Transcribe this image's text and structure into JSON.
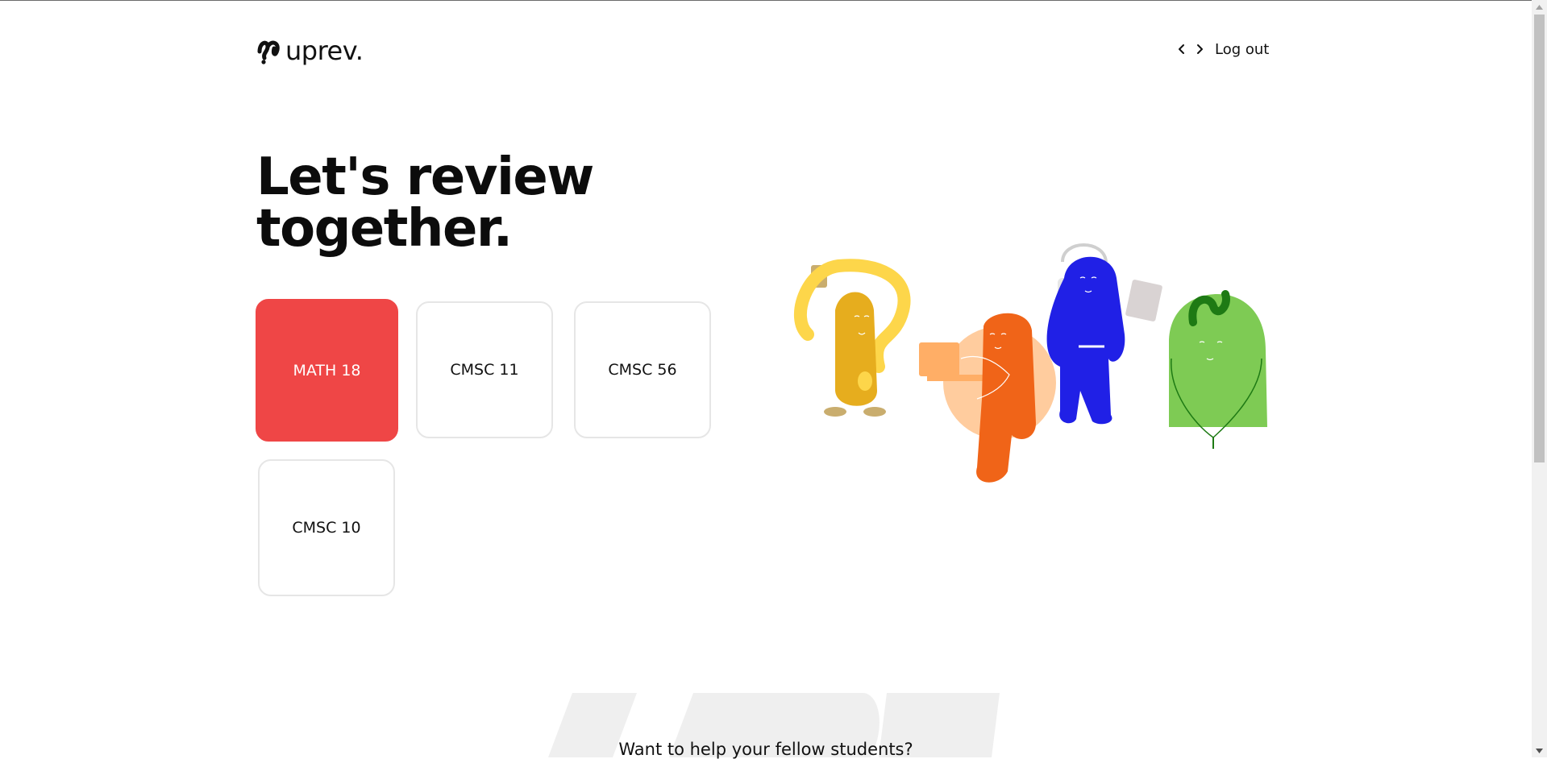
{
  "brand": {
    "name": "uprev."
  },
  "nav": {
    "back_icon": "chevron-left-icon",
    "forward_icon": "chevron-right-icon",
    "logout_label": "Log out"
  },
  "hero": {
    "headline_line1": "Let's review",
    "headline_line2": "together."
  },
  "courses": [
    {
      "label": "MATH 18",
      "selected": true
    },
    {
      "label": "CMSC 11",
      "selected": false
    },
    {
      "label": "CMSC 56",
      "selected": false
    },
    {
      "label": "CMSC 10",
      "selected": false
    }
  ],
  "footer_section": {
    "prompt": "Want to help your fellow students?"
  },
  "colors": {
    "accent": "#ef4646",
    "yellow": "#f2c12e",
    "orange": "#f06418",
    "blue": "#2222e6",
    "green": "#7ecb54"
  }
}
